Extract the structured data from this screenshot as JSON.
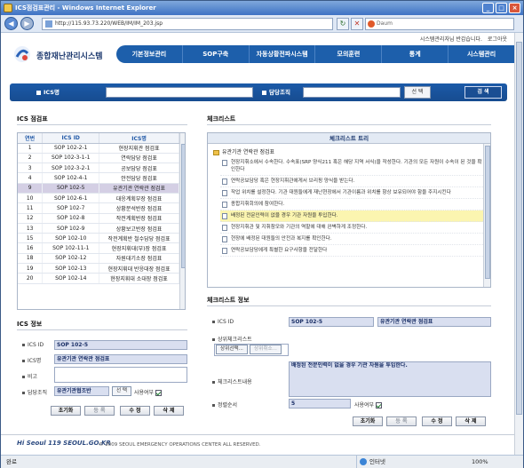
{
  "window": {
    "title": "ICS점검표관리 - Windows Internet Explorer"
  },
  "browser": {
    "url": "http://115.93.73.220/WEB/IM/IM_203.jsp",
    "search_placeholder": "Daum",
    "status_left": "완료",
    "status_zone": "인터넷",
    "zoom": "100%"
  },
  "header": {
    "toplinks": [
      "시스템관리자님 반갑습니다.",
      "로그아웃"
    ],
    "logo_text": "종합재난관리시스템",
    "nav": [
      "기본정보관리",
      "SOP구축",
      "자동상황전파시스템",
      "모의훈련",
      "통계",
      "시스템관리"
    ]
  },
  "search": {
    "ics_label": "ICS명",
    "ics_value": "",
    "owner_label": "담당조직",
    "owner_value": "",
    "select_btn": "선 택",
    "search_btn": "검 색"
  },
  "checklist_panel": {
    "title": "ICS 점검표",
    "columns": [
      "연번",
      "ICS ID",
      "ICS명"
    ],
    "rows": [
      {
        "no": "1",
        "id": "SOP 102-2-1",
        "name": "현장지휘관 점검표"
      },
      {
        "no": "2",
        "id": "SOP 102-3-1-1",
        "name": "연락담당 점검표"
      },
      {
        "no": "3",
        "id": "SOP 102-3-2-1",
        "name": "공보담당 점검표"
      },
      {
        "no": "4",
        "id": "SOP 102-4-1",
        "name": "안전담당 점검표"
      },
      {
        "no": "9",
        "id": "SOP 102-5",
        "name": "유관기관 연락관 점검표",
        "selected": true
      },
      {
        "no": "10",
        "id": "SOP 102-6-1",
        "name": "대응계획부장 점검표"
      },
      {
        "no": "11",
        "id": "SOP 102-7",
        "name": "상황분석반장 점검표"
      },
      {
        "no": "12",
        "id": "SOP 102-8",
        "name": "작전계획반장 점검표"
      },
      {
        "no": "13",
        "id": "SOP 102-9",
        "name": "상황보고반장 점검표"
      },
      {
        "no": "15",
        "id": "SOP 102-10",
        "name": "작전계획반 철수담당 점검표"
      },
      {
        "no": "16",
        "id": "SOP 102-11-1",
        "name": "현장지휘대(부)장 점검표"
      },
      {
        "no": "18",
        "id": "SOP 102-12",
        "name": "자원대기소장 점검표"
      },
      {
        "no": "19",
        "id": "SOP 102-13",
        "name": "현장지휘대 반응대장 점검표"
      },
      {
        "no": "20",
        "id": "SOP 102-14",
        "name": "현장지휘대 소대장 점검표"
      }
    ]
  },
  "ics_info": {
    "title": "ICS 정보",
    "id_label": "ICS ID",
    "id_value": "SOP 102-5",
    "name_label": "ICS명",
    "name_value": "유관기관 연락관 점검표",
    "note_label": "비고",
    "note_value": "",
    "owner_label": "담당조직",
    "owner_value": "유관기관협조반",
    "select_btn": "선 택",
    "use_label": "사용여부",
    "buttons": [
      "초기화",
      "등 록",
      "수 정",
      "삭 제"
    ]
  },
  "checklist": {
    "title": "체크리스트",
    "tree_title": "체크리스트 트리",
    "root": "유관기관 연락관 점검표",
    "items": [
      "현장지휘소에서 수속한다. 수속표(SRP 양식211 혹은 해당 지역 서식)을 작성한다. 기관의 모든 자원이 수속이 된 것을 확인한다",
      "연락공보담당 혹은 현장지휘관에게서 브리핑 양식을 받는다.",
      "작업 위치를 설정한다. 기관 대원들에게 재난현장에서 기관이름과 위치를 항상 보유되어야 함을 주지시킨다",
      "종합지휘회의에 참여한다.",
      "배정된 전문인력이 없을 경우 기관 자원을 투입한다.",
      "현장지휘관 및 지휘참모와 기관의 역할에 대해 완벽하게 조정한다.",
      "현장에 배정된 대원들의 안전과 복지를 확인한다.",
      "연락공보담당에게 특별한 요구사항을 전달한다"
    ],
    "highlight_index": 4
  },
  "checklist_info": {
    "title": "체크리스트 정보",
    "ics_id_label": "ICS ID",
    "ics_id_value": "SOP 102-5",
    "ics_name_value": "유관기관 연락관 점검표",
    "parent_label": "상위체크리스트",
    "parent_select_btn": "상위선택...",
    "parent_clear_btn": "상위취소...",
    "content_label": "체크리스트내용",
    "content_value": "배정된 전문인력이 없을 경우 기관 자원을 투입한다.",
    "order_label": "정렬순서",
    "order_value": "5",
    "use_label": "사용여부",
    "buttons": [
      "초기화",
      "등 록",
      "수 정",
      "삭 제"
    ]
  },
  "footer": {
    "logo": "Hi Seoul 119 SEOUL.GO.KR",
    "copyright": "© 2009 SEOUL EMERGENCY OPERATIONS CENTER ALL RESERVED."
  }
}
